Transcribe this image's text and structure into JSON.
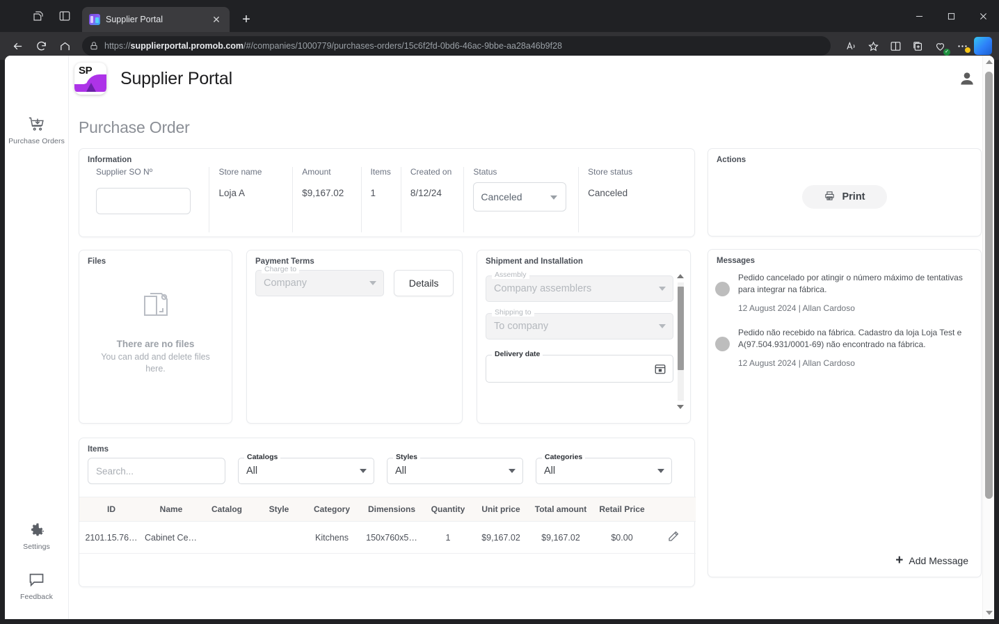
{
  "browser": {
    "tab_title": "Supplier Portal",
    "url_domain": "supplierportal.promob.com",
    "url_prefix": "https://",
    "url_path": "/#/companies/1000779/purchases-orders/15c6f2fd-0bd6-46ac-9bbe-aa28a46b9f28",
    "new_tab_label": "+",
    "close_tab_label": "✕"
  },
  "app": {
    "logo_text": "SP",
    "title": "Supplier Portal",
    "page_title": "Purchase Order"
  },
  "rail": {
    "top_item": {
      "label": "Purchase Orders",
      "icon": "cart-download-icon"
    },
    "bottom_items": [
      {
        "label": "Settings",
        "icon": "gear-icon"
      },
      {
        "label": "Feedback",
        "icon": "comment-icon"
      }
    ]
  },
  "information": {
    "section_label": "Information",
    "fields": [
      {
        "header": "Supplier SO Nº",
        "value": "",
        "type": "input",
        "placeholder": ""
      },
      {
        "header": "Store name",
        "value": "Loja A",
        "type": "text"
      },
      {
        "header": "Amount",
        "value": "$9,167.02",
        "type": "text"
      },
      {
        "header": "Items",
        "value": "1",
        "type": "text"
      },
      {
        "header": "Created on",
        "value": "8/12/24",
        "type": "text"
      },
      {
        "header": "Status",
        "value": "Canceled",
        "type": "select"
      },
      {
        "header": "Store status",
        "value": "Canceled",
        "type": "text"
      }
    ]
  },
  "files": {
    "section_label": "Files",
    "empty_title": "There are no files",
    "empty_subtitle": "You can add and delete files here."
  },
  "payment_terms": {
    "section_label": "Payment Terms",
    "charge_to_label": "Charge to",
    "charge_to_value": "Company",
    "details_label": "Details"
  },
  "shipment": {
    "section_label": "Shipment and Installation",
    "assembly_label": "Assembly",
    "assembly_value": "Company assemblers",
    "shipping_to_label": "Shipping to",
    "shipping_to_value": "To company",
    "delivery_date_label": "Delivery date",
    "delivery_date_value": "",
    "calendar_icon": "calendar-icon"
  },
  "items": {
    "section_label": "Items",
    "search_placeholder": "Search...",
    "filters": [
      {
        "label": "Catalogs",
        "value": "All"
      },
      {
        "label": "Styles",
        "value": "All"
      },
      {
        "label": "Categories",
        "value": "All"
      }
    ],
    "columns": [
      "ID",
      "Name",
      "Catalog",
      "Style",
      "Category",
      "Dimensions",
      "Quantity",
      "Unit price",
      "Total amount",
      "Retail Price",
      ""
    ],
    "rows": [
      {
        "id": "2101.15.76…",
        "name": "Cabinet Cel…",
        "catalog": "",
        "style": "",
        "category": "Kitchens",
        "dimensions": "150x760x5…",
        "quantity": "1",
        "unit_price": "$9,167.02",
        "total_amount": "$9,167.02",
        "retail_price": "$0.00",
        "edit_icon": "pencil-icon"
      }
    ]
  },
  "actions": {
    "section_label": "Actions",
    "print_label": "Print",
    "print_icon": "printer-icon"
  },
  "messages": {
    "section_label": "Messages",
    "items": [
      {
        "text": "Pedido cancelado por atingir o número máximo de tentativas para integrar na fábrica.",
        "meta": "12 August 2024 | Allan Cardoso"
      },
      {
        "text": "Pedido não recebido na fábrica. Cadastro da loja Loja Test e A(97.504.931/0001-69) não encontrado na fábrica.",
        "meta": "12 August 2024 | Allan Cardoso"
      }
    ],
    "add_label": "Add Message",
    "add_icon": "plus-icon"
  },
  "colors": {
    "accent_purple": "#ad33e8",
    "page_title_gray": "#8b8f96",
    "card_border": "#e9ebee",
    "table_header_bg": "#faf8f6"
  }
}
